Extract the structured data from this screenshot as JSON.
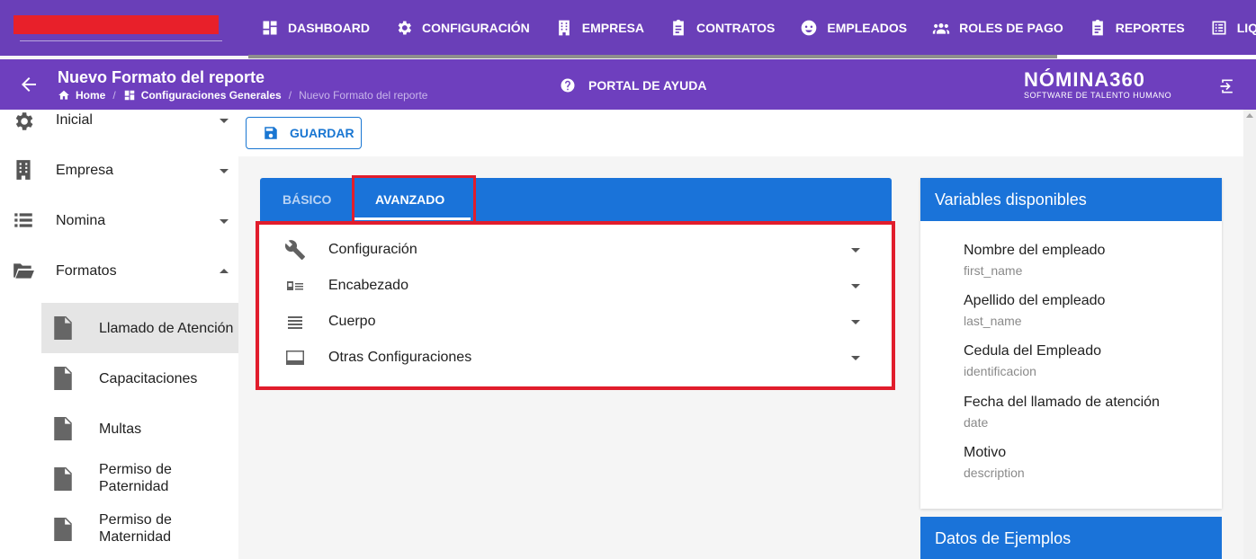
{
  "nav": {
    "items": [
      {
        "label": "DASHBOARD",
        "icon": "dashboard-icon"
      },
      {
        "label": "CONFIGURACIÓN",
        "icon": "gear-icon"
      },
      {
        "label": "EMPRESA",
        "icon": "building-icon"
      },
      {
        "label": "CONTRATOS",
        "icon": "clipboard-icon"
      },
      {
        "label": "EMPLEADOS",
        "icon": "face-icon"
      },
      {
        "label": "ROLES DE PAGO",
        "icon": "group-icon"
      },
      {
        "label": "REPORTES",
        "icon": "report-icon"
      },
      {
        "label": "LIQU",
        "icon": "list-icon"
      }
    ]
  },
  "header": {
    "title": "Nuevo Formato del reporte",
    "breadcrumb": {
      "home": "Home",
      "section": "Configuraciones Generales",
      "current": "Nuevo Formato del reporte",
      "separator": "/"
    },
    "help_label": "PORTAL DE AYUDA",
    "brand_name": "NÓMINA360",
    "brand_tagline": "SOFTWARE DE TALENTO HUMANO"
  },
  "sidebar": {
    "sections": [
      {
        "label": "Inicial",
        "icon": "gear-icon",
        "expanded": false
      },
      {
        "label": "Empresa",
        "icon": "building-icon",
        "expanded": false
      },
      {
        "label": "Nomina",
        "icon": "list-icon",
        "expanded": false
      },
      {
        "label": "Formatos",
        "icon": "folder-open-icon",
        "expanded": true
      }
    ],
    "formatos_items": [
      {
        "label": "Llamado de Atención",
        "active": true
      },
      {
        "label": "Capacitaciones",
        "active": false
      },
      {
        "label": "Multas",
        "active": false
      },
      {
        "label": "Permiso de Paternidad",
        "active": false
      },
      {
        "label": "Permiso de Maternidad",
        "active": false
      }
    ]
  },
  "toolbar": {
    "save_label": "GUARDAR"
  },
  "tabs": {
    "items": [
      {
        "label": "BÁSICO",
        "active": false
      },
      {
        "label": "AVANZADO",
        "active": true
      }
    ]
  },
  "panels": [
    {
      "label": "Configuración",
      "icon": "wrench-icon"
    },
    {
      "label": "Encabezado",
      "icon": "id-card-icon"
    },
    {
      "label": "Cuerpo",
      "icon": "text-lines-icon"
    },
    {
      "label": "Otras Configuraciones",
      "icon": "web-asset-icon"
    }
  ],
  "variables": {
    "title": "Variables disponibles",
    "items": [
      {
        "name": "Nombre del empleado",
        "key": "first_name"
      },
      {
        "name": "Apellido del empleado",
        "key": "last_name"
      },
      {
        "name": "Cedula del Empleado",
        "key": "identificacion"
      },
      {
        "name": "Fecha del llamado de atención",
        "key": "date"
      },
      {
        "name": "Motivo",
        "key": "description"
      }
    ]
  },
  "examples": {
    "title": "Datos de Ejemplos"
  },
  "colors": {
    "primary_purple": "#6a3fb8",
    "tab_blue": "#1a73d9",
    "highlight_red": "#e11d2c"
  }
}
